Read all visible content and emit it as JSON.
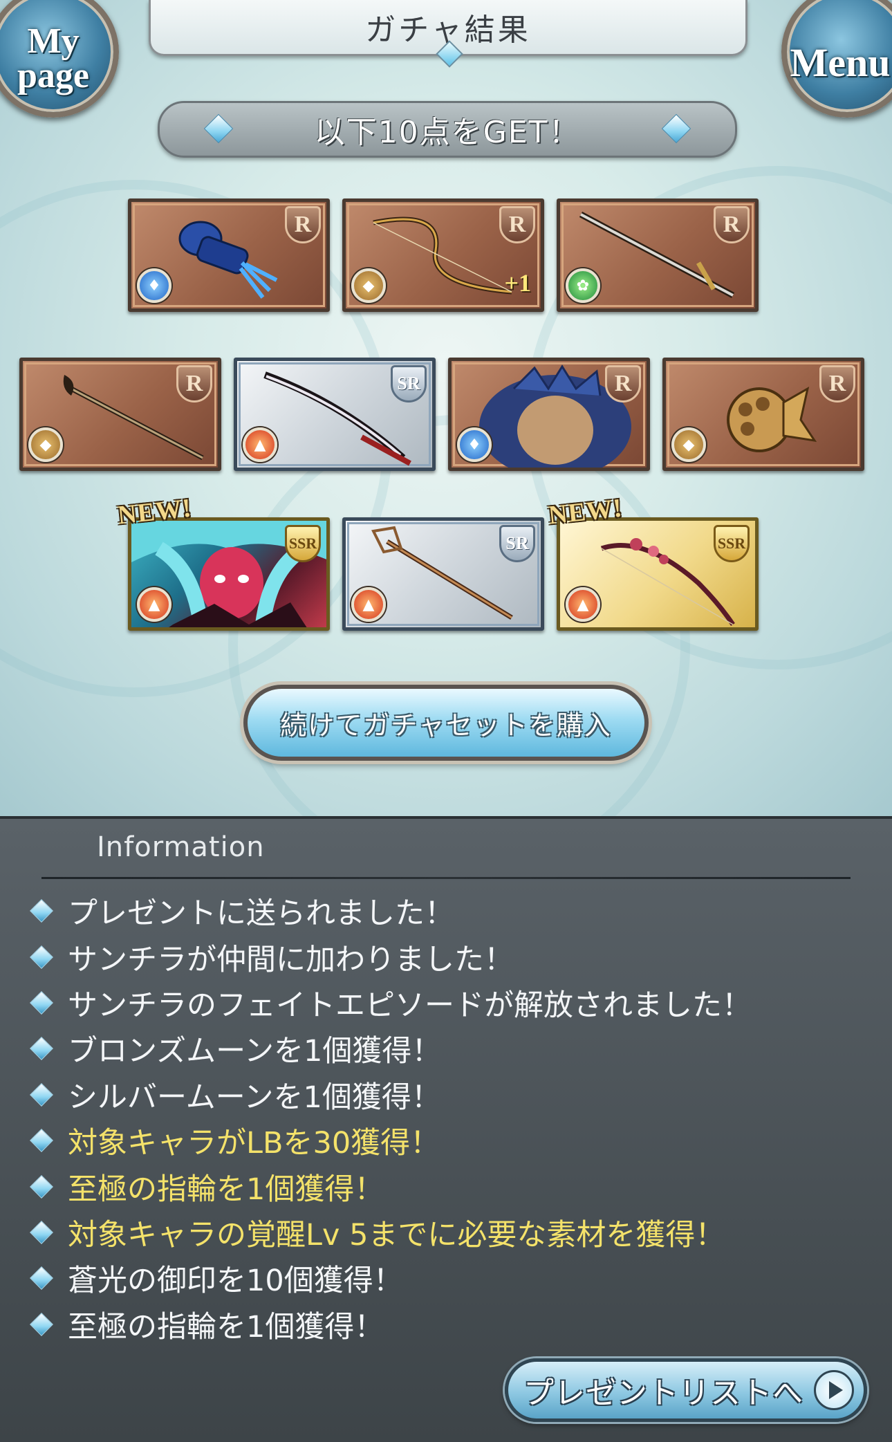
{
  "header": {
    "title": "ガチャ結果",
    "mypage_label": "My page",
    "menu_label": "Menu"
  },
  "banner": {
    "text": "以下10点をGET！"
  },
  "results": [
    {
      "rarity": "R",
      "element": "water",
      "item": "gauntlet",
      "plus": "",
      "new": ""
    },
    {
      "rarity": "R",
      "element": "earth",
      "item": "bow",
      "plus": "+1",
      "new": ""
    },
    {
      "rarity": "R",
      "element": "wind",
      "item": "sword",
      "plus": "",
      "new": ""
    },
    {
      "rarity": "R",
      "element": "earth",
      "item": "staff",
      "plus": "",
      "new": ""
    },
    {
      "rarity": "SR",
      "element": "fire",
      "item": "katana",
      "plus": "",
      "new": ""
    },
    {
      "rarity": "R",
      "element": "water",
      "item": "summon",
      "plus": "",
      "new": ""
    },
    {
      "rarity": "R",
      "element": "earth",
      "item": "knuckle",
      "plus": "",
      "new": ""
    },
    {
      "rarity": "SSR",
      "element": "fire",
      "item": "character",
      "plus": "",
      "new": "NEW!"
    },
    {
      "rarity": "SR",
      "element": "fire",
      "item": "staff",
      "plus": "",
      "new": ""
    },
    {
      "rarity": "SSR",
      "element": "fire",
      "item": "bow",
      "plus": "",
      "new": "NEW!"
    }
  ],
  "buy_button": {
    "label": "続けてガチャセットを購入"
  },
  "info": {
    "title": "Information",
    "items": [
      {
        "text": "プレゼントに送られました！",
        "highlight": false
      },
      {
        "text": "サンチラが仲間に加わりました！",
        "highlight": false
      },
      {
        "text": "サンチラのフェイトエピソードが解放されました！",
        "highlight": false
      },
      {
        "text": "ブロンズムーンを1個獲得！",
        "highlight": false
      },
      {
        "text": "シルバームーンを1個獲得！",
        "highlight": false
      },
      {
        "text": "対象キャラがLBを30獲得！",
        "highlight": true
      },
      {
        "text": "至極の指輪を1個獲得！",
        "highlight": true
      },
      {
        "text": "対象キャラの覚醒Lv 5までに必要な素材を獲得！",
        "highlight": true
      },
      {
        "text": "蒼光の御印を10個獲得！",
        "highlight": false
      },
      {
        "text": "至極の指輪を1個獲得！",
        "highlight": false
      }
    ]
  },
  "present_button": {
    "label": "プレゼントリストへ"
  },
  "colors": {
    "highlight_text": "#f4e26a",
    "panel_bg": "#4a5258",
    "accent_blue": "#8fd6f2"
  }
}
